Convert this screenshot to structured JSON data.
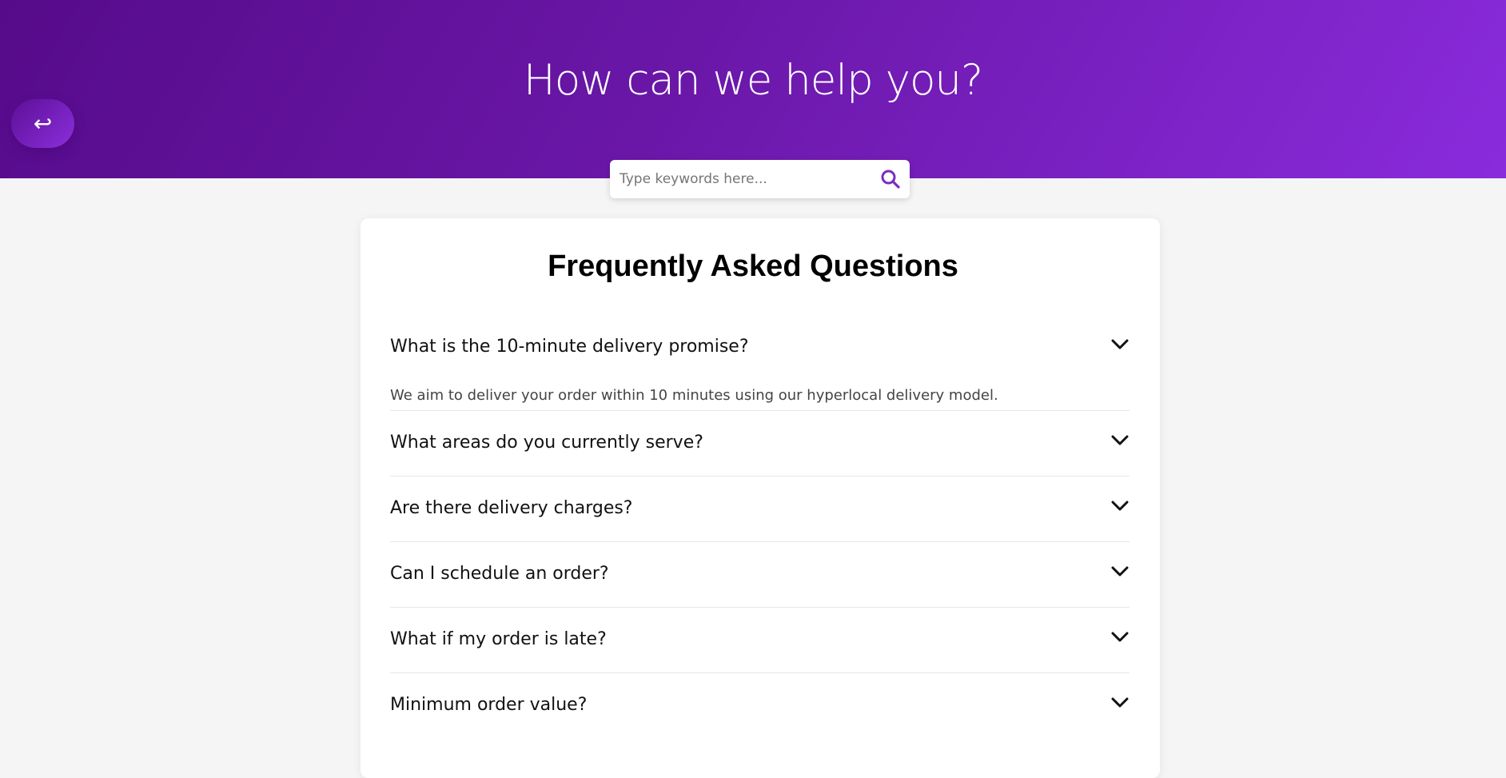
{
  "hero": {
    "title": "How can we help you?"
  },
  "back_button": {
    "icon": "return-arrow-icon",
    "glyph": "↩"
  },
  "search": {
    "placeholder": "Type keywords here...",
    "value": "",
    "icon": "search-icon",
    "accent": "#7b2cbf"
  },
  "faq": {
    "title": "Frequently Asked Questions",
    "items": [
      {
        "question": "What is the 10-minute delivery promise?",
        "answer": "We aim to deliver your order within 10 minutes using our hyperlocal delivery model.",
        "expanded": true
      },
      {
        "question": "What areas do you currently serve?",
        "expanded": false
      },
      {
        "question": "Are there delivery charges?",
        "expanded": false
      },
      {
        "question": "Can I schedule an order?",
        "expanded": false
      },
      {
        "question": "What if my order is late?",
        "expanded": false
      },
      {
        "question": "Minimum order value?",
        "expanded": false
      }
    ]
  },
  "colors": {
    "hero_start": "#560b8a",
    "hero_end": "#8a2bdc",
    "background": "#f5f5f5",
    "card": "#ffffff"
  }
}
